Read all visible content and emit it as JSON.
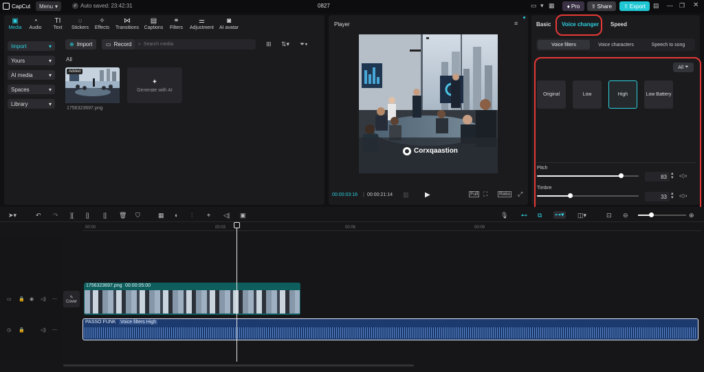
{
  "titlebar": {
    "app_name": "CapCut",
    "menu_label": "Menu",
    "autosave_text": "Auto saved: 23:42:31",
    "project_title": "0827",
    "pro_label": "Pro",
    "share_label": "Share",
    "export_label": "Export"
  },
  "toolbar": {
    "tools": [
      {
        "label": "Media",
        "icon": "media-icon"
      },
      {
        "label": "Audio",
        "icon": "audio-icon"
      },
      {
        "label": "Text",
        "icon": "text-icon"
      },
      {
        "label": "Stickers",
        "icon": "stickers-icon"
      },
      {
        "label": "Effects",
        "icon": "effects-icon"
      },
      {
        "label": "Transitions",
        "icon": "transitions-icon"
      },
      {
        "label": "Captions",
        "icon": "captions-icon"
      },
      {
        "label": "Filters",
        "icon": "filters-icon"
      },
      {
        "label": "Adjustment",
        "icon": "adjustment-icon"
      },
      {
        "label": "AI avatar",
        "icon": "ai-avatar-icon"
      }
    ]
  },
  "sidebar": {
    "items": [
      {
        "label": "Import"
      },
      {
        "label": "Yours"
      },
      {
        "label": "AI media"
      },
      {
        "label": "Spaces"
      },
      {
        "label": "Library"
      }
    ]
  },
  "media": {
    "import_label": "Import",
    "record_label": "Record",
    "search_placeholder": "Search media",
    "section_all": "All",
    "added_badge": "Added",
    "file_name": "1756323697.png",
    "generate_label": "Generate with AI"
  },
  "player": {
    "title": "Player",
    "brand_text": "Corxqaastion",
    "current_time": "00:00:03:16",
    "total_time": "00:00:21:14",
    "ratio_label": "Ratio"
  },
  "right_panel": {
    "tabs": [
      {
        "label": "Basic"
      },
      {
        "label": "Voice changer"
      },
      {
        "label": "Speed"
      }
    ],
    "subtabs": [
      {
        "label": "Voice filters"
      },
      {
        "label": "Voice characters"
      },
      {
        "label": "Speech to song"
      }
    ],
    "filter_all_label": "All",
    "voice_options": [
      {
        "label": "Original"
      },
      {
        "label": "Low"
      },
      {
        "label": "High"
      },
      {
        "label": "Low Battery"
      }
    ],
    "pitch": {
      "label": "Pitch",
      "value": "83",
      "level": 0.83
    },
    "timbre": {
      "label": "Timbre",
      "value": "33",
      "level": 0.33
    }
  },
  "timeline": {
    "ruler_labels": [
      "00:00",
      "00:03",
      "00:06",
      "00:09"
    ],
    "cover_label": "Cover",
    "video_clip": {
      "name": "1756323697.png",
      "duration": "00:00:05:00"
    },
    "audio_clip": {
      "name": "PASSO FUNK",
      "effect": "Voice filters High"
    }
  },
  "colors": {
    "accent": "#2cd0de",
    "highlight": "#e53935",
    "audio_track": "#1c3a6e",
    "video_track": "#0e5e5e"
  }
}
